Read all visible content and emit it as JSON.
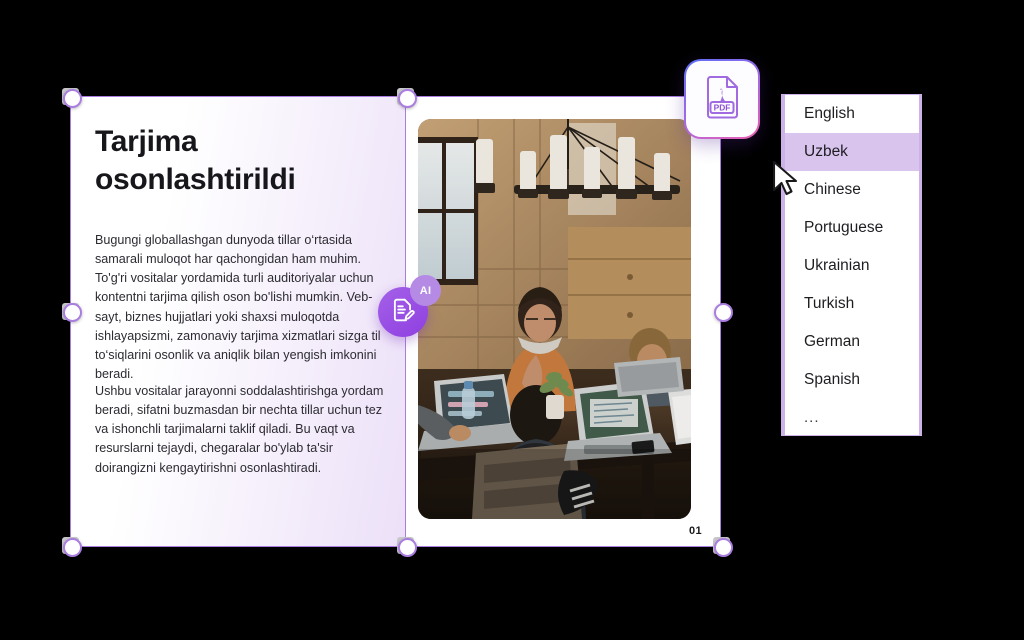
{
  "document": {
    "headline": "Tarjima osonlashtirildi",
    "paragraph_1": "Bugungi globallashgan dunyoda tillar o‘rtasida samarali muloqot har qachongidan ham muhim. To'g'ri vositalar yordamida turli auditoriyalar uchun kontentni tarjima qilish oson bo'lishi mumkin. Veb-sayt, biznes hujjatlari yoki shaxsi muloqotda ishlayapsizmi, zamonaviy tarjima xizmatlari sizga til to‘siqlarini osonlik va aniqlik bilan yengish imkonini beradi.",
    "paragraph_2": "Ushbu vositalar jarayonni soddalashtirishga yordam beradi, sifatni buzmasdan bir nechta tillar uchun tez va ishonchli tarjimalarni taklif qiladi. Bu vaqt va resurslarni tejaydi, chegaralar bo'ylab ta'sir doirangizni kengaytirishni osonlashtiradi.",
    "page_number": "01",
    "photo_alt": "people working on laptops at a wooden table in a cabin"
  },
  "badges": {
    "ai_label": "AI",
    "ai_icon": "document-pen-icon",
    "pdf_icon": "pdf-file-icon",
    "pdf_label": "PDF"
  },
  "language_menu": {
    "selected": "Uzbek",
    "items": [
      {
        "label": "English"
      },
      {
        "label": "Uzbek"
      },
      {
        "label": "Chinese"
      },
      {
        "label": "Portuguese"
      },
      {
        "label": "Ukrainian"
      },
      {
        "label": "Turkish"
      },
      {
        "label": "German"
      },
      {
        "label": "Spanish"
      },
      {
        "label": "..."
      }
    ]
  },
  "colors": {
    "accent_purple": "#a97ee0",
    "selection_highlight": "#d9c4ee",
    "ai_badge": "#8f3fe0",
    "page_gradient_end": "#ece0f8",
    "canvas_background": "#000000"
  }
}
